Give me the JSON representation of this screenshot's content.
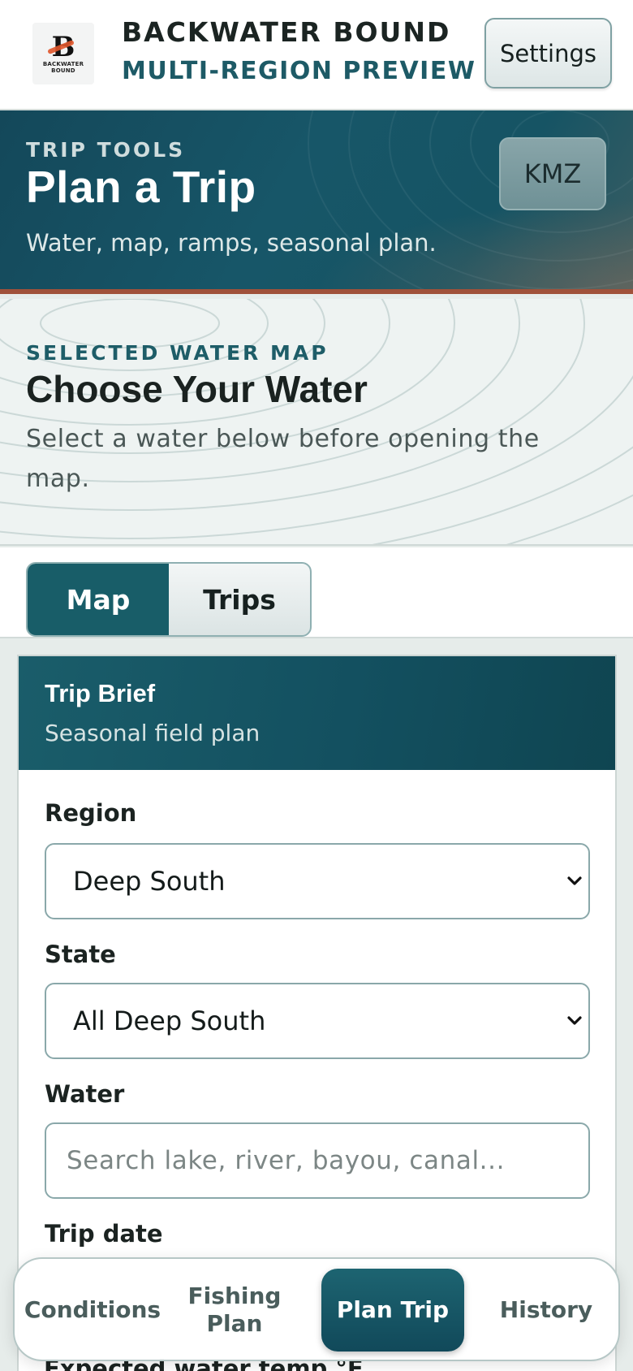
{
  "header": {
    "logo_text": "BACKWATER BOUND",
    "logo_mark": "B",
    "brand_title": "BACKWATER BOUND",
    "brand_subtitle": "MULTI-REGION PREVIEW",
    "settings_label": "Settings"
  },
  "hero": {
    "eyebrow": "TRIP TOOLS",
    "title": "Plan a Trip",
    "subtitle": "Water, map, ramps, seasonal plan.",
    "kmz_label": "KMZ"
  },
  "water_section": {
    "eyebrow": "SELECTED WATER MAP",
    "title": "Choose Your Water",
    "description": "Select a water below before opening the map."
  },
  "tabs": [
    {
      "label": "Map",
      "active": true
    },
    {
      "label": "Trips",
      "active": false
    }
  ],
  "trip_brief": {
    "title": "Trip Brief",
    "subtitle": "Seasonal field plan",
    "region": {
      "label": "Region",
      "value": "Deep South"
    },
    "state": {
      "label": "State",
      "value": "All Deep South"
    },
    "water": {
      "label": "Water",
      "value": "",
      "placeholder": "Search lake, river, bayou, canal..."
    },
    "trip_date": {
      "label": "Trip date"
    },
    "water_temp": {
      "label": "Expected water temp °F"
    }
  },
  "bottom_nav": [
    {
      "label": "Conditions",
      "active": false
    },
    {
      "label": "Fishing Plan",
      "active": false
    },
    {
      "label": "Plan Trip",
      "active": true
    },
    {
      "label": "History",
      "active": false
    }
  ],
  "colors": {
    "brand_teal": "#185d68",
    "accent_rust": "#a0513a",
    "text_dark": "#16201f"
  }
}
